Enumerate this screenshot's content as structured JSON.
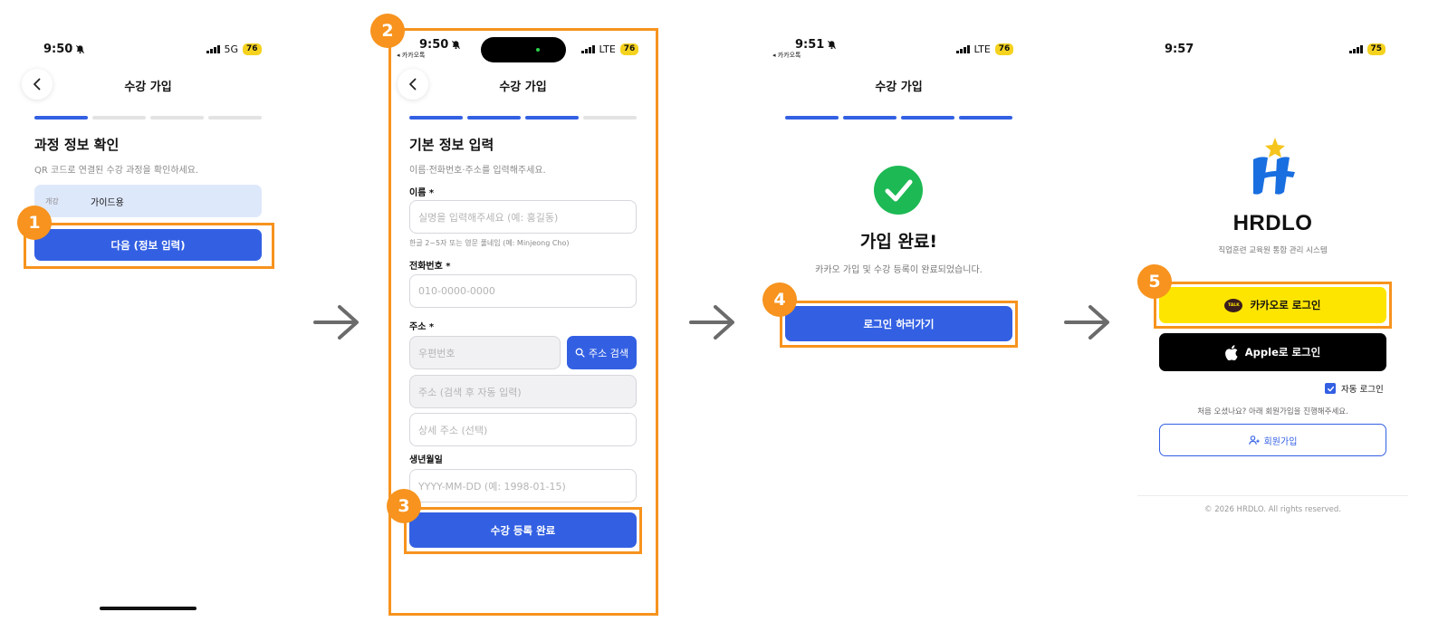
{
  "screens": {
    "s1": {
      "time": "9:50",
      "network": "5G",
      "battery": "76",
      "title": "수강 가입",
      "heading": "과정 정보 확인",
      "subtitle": "QR 코드로 연결된 수강 과정을 확인하세요.",
      "course_label": "개강",
      "course_value": "가이드용",
      "next_button": "다음 (정보 입력)",
      "badge": "1"
    },
    "s2": {
      "time": "9:50",
      "carrier": "◂ 카카오톡",
      "network": "LTE",
      "battery": "76",
      "title": "수강 가입",
      "heading": "기본 정보 입력",
      "subtitle": "이름·전화번호·주소를 입력해주세요.",
      "name_label": "이름 *",
      "name_placeholder": "실명을 입력해주세요 (예: 홍길동)",
      "name_hint": "한글 2~5자 또는 영문 풀네임 (예: Minjeong Cho)",
      "phone_label": "전화번호 *",
      "phone_placeholder": "010-0000-0000",
      "address_label": "주소 *",
      "zipcode_placeholder": "우편번호",
      "address_search_button": "주소 검색",
      "address_placeholder": "주소 (검색 후 자동 입력)",
      "address_detail_placeholder": "상세 주소 (선택)",
      "birth_label": "생년월일",
      "birth_placeholder": "YYYY-MM-DD (예: 1998-01-15)",
      "submit_button": "수강 등록 완료",
      "badge_top": "2",
      "badge_submit": "3"
    },
    "s3": {
      "time": "9:51",
      "carrier": "◂ 카카오톡",
      "network": "LTE",
      "battery": "76",
      "title": "수강 가입",
      "heading": "가입 완료!",
      "message": "카카오 가입 및 수강 등록이 완료되었습니다.",
      "login_button": "로그인 하러가기",
      "badge": "4"
    },
    "s4": {
      "time": "9:57",
      "battery": "75",
      "brand": "HRDLO",
      "tagline": "직업훈련 교육원 통합 관리 시스템",
      "kakao_button": "카카오로 로그인",
      "kakao_talk": "TALK",
      "apple_button": "Apple로 로그인",
      "auto_login": "자동 로그인",
      "signup_prompt": "처음 오셨나요? 아래 회원가입을 진행해주세요.",
      "signup_button": "회원가입",
      "copyright": "© 2026 HRDLO. All rights reserved.",
      "badge": "5"
    }
  },
  "colors": {
    "primary": "#3360e3",
    "highlight": "#f7931e",
    "kakao": "#fee500",
    "success": "#1db954",
    "battery": "#f5d21e"
  }
}
